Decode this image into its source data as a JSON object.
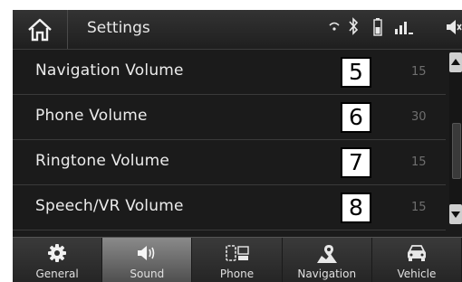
{
  "header": {
    "title": "Settings"
  },
  "rows": [
    {
      "label": "Navigation Volume",
      "number": "5",
      "value": "15"
    },
    {
      "label": "Phone Volume",
      "number": "6",
      "value": "30"
    },
    {
      "label": "Ringtone Volume",
      "number": "7",
      "value": "15"
    },
    {
      "label": "Speech/VR Volume",
      "number": "8",
      "value": "15"
    }
  ],
  "tabs": [
    {
      "label": "General",
      "icon": "gear-icon"
    },
    {
      "label": "Sound",
      "icon": "speaker-icon",
      "active": true
    },
    {
      "label": "Phone",
      "icon": "phone-icon"
    },
    {
      "label": "Navigation",
      "icon": "map-pin-icon"
    },
    {
      "label": "Vehicle",
      "icon": "car-icon"
    }
  ],
  "status_icons": [
    "wifi-icon",
    "bluetooth-icon",
    "battery-icon",
    "signal-icon",
    "volume-mute-icon"
  ]
}
